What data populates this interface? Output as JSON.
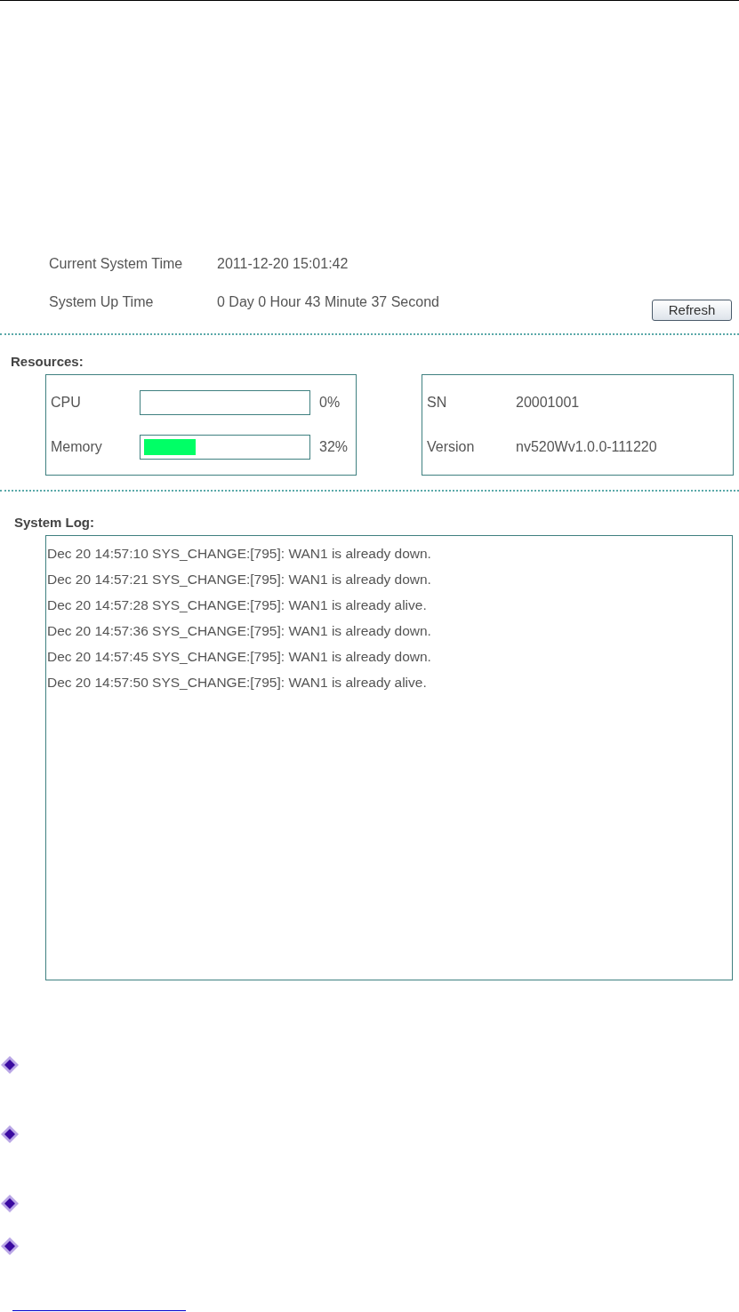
{
  "system_info": [
    {
      "label": "Current System Time",
      "value": "2011-12-20 15:01:42"
    },
    {
      "label": "System Up Time",
      "value": "0 Day 0 Hour 43 Minute 37 Second"
    }
  ],
  "refresh_button": "Refresh",
  "resources": {
    "title": "Resources:",
    "meters": [
      {
        "label": "CPU",
        "level": 0,
        "reading": "0%"
      },
      {
        "label": "Memory",
        "level": 0.32,
        "reading": "32%"
      }
    ],
    "device": [
      {
        "label": "SN",
        "value": "20001001"
      },
      {
        "label": "Version",
        "value": "nv520Wv1.0.0-111220"
      }
    ]
  },
  "system_log": {
    "title": "System Log:",
    "lines": [
      "Dec 20 14:57:10 SYS_CHANGE:[795]: WAN1 is already down.",
      "Dec 20 14:57:21 SYS_CHANGE:[795]: WAN1 is already down.",
      "Dec 20 14:57:28 SYS_CHANGE:[795]: WAN1 is already alive.",
      "Dec 20 14:57:36 SYS_CHANGE:[795]: WAN1 is already down.",
      "Dec 20 14:57:45 SYS_CHANGE:[795]: WAN1 is already down.",
      "Dec 20 14:57:50 SYS_CHANGE:[795]: WAN1 is already alive."
    ]
  }
}
